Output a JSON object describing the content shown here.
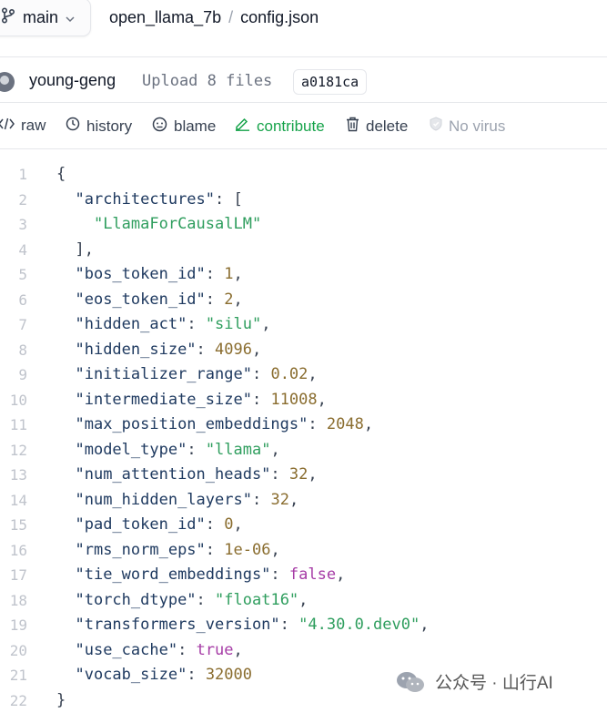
{
  "breadcrumb": {
    "branch": "main",
    "repo": "open_llama_7b",
    "separator": "/",
    "file": "config.json"
  },
  "commit": {
    "author": "young-geng",
    "message": "Upload 8 files",
    "hash": "a0181ca"
  },
  "actions": {
    "raw": "raw",
    "history": "history",
    "blame": "blame",
    "contribute": "contribute",
    "delete": "delete",
    "no_virus": "No virus"
  },
  "code_lines": [
    {
      "n": "1",
      "t": "{"
    },
    {
      "n": "2",
      "t": "  \"architectures\": ["
    },
    {
      "n": "3",
      "t": "    \"LlamaForCausalLM\""
    },
    {
      "n": "4",
      "t": "  ],"
    },
    {
      "n": "5",
      "t": "  \"bos_token_id\": 1,"
    },
    {
      "n": "6",
      "t": "  \"eos_token_id\": 2,"
    },
    {
      "n": "7",
      "t": "  \"hidden_act\": \"silu\","
    },
    {
      "n": "8",
      "t": "  \"hidden_size\": 4096,"
    },
    {
      "n": "9",
      "t": "  \"initializer_range\": 0.02,"
    },
    {
      "n": "10",
      "t": "  \"intermediate_size\": 11008,"
    },
    {
      "n": "11",
      "t": "  \"max_position_embeddings\": 2048,"
    },
    {
      "n": "12",
      "t": "  \"model_type\": \"llama\","
    },
    {
      "n": "13",
      "t": "  \"num_attention_heads\": 32,"
    },
    {
      "n": "14",
      "t": "  \"num_hidden_layers\": 32,"
    },
    {
      "n": "15",
      "t": "  \"pad_token_id\": 0,"
    },
    {
      "n": "16",
      "t": "  \"rms_norm_eps\": 1e-06,"
    },
    {
      "n": "17",
      "t": "  \"tie_word_embeddings\": false,"
    },
    {
      "n": "18",
      "t": "  \"torch_dtype\": \"float16\","
    },
    {
      "n": "19",
      "t": "  \"transformers_version\": \"4.30.0.dev0\","
    },
    {
      "n": "20",
      "t": "  \"use_cache\": true,"
    },
    {
      "n": "21",
      "t": "  \"vocab_size\": 32000"
    },
    {
      "n": "22",
      "t": "}"
    }
  ],
  "watermark": {
    "text": "公众号 · 山行AI"
  },
  "colors": {
    "key": "#1f3a60",
    "string": "#2f9e5e",
    "number": "#8a6d2f",
    "boolean": "#a63ca6",
    "contribute": "#16a34a",
    "line_number": "#c0c4cc"
  }
}
